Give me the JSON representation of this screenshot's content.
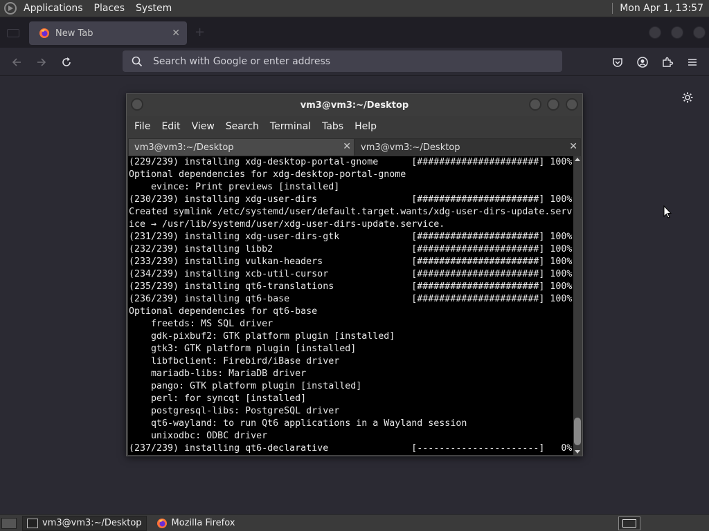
{
  "top_panel": {
    "menus": [
      "Applications",
      "Places",
      "System"
    ],
    "clock": "Mon Apr 1, 13:57"
  },
  "firefox": {
    "tab_title": "New Tab",
    "address_placeholder": "Search with Google or enter address"
  },
  "terminal": {
    "window_title": "vm3@vm3:~/Desktop",
    "menu": [
      "File",
      "Edit",
      "View",
      "Search",
      "Terminal",
      "Tabs",
      "Help"
    ],
    "tabs": [
      "vm3@vm3:~/Desktop",
      "vm3@vm3:~/Desktop"
    ],
    "lines": [
      "(229/239) installing xdg-desktop-portal-gnome      [######################] 100%",
      "Optional dependencies for xdg-desktop-portal-gnome",
      "    evince: Print previews [installed]",
      "(230/239) installing xdg-user-dirs                 [######################] 100%",
      "Created symlink /etc/systemd/user/default.target.wants/xdg-user-dirs-update.serv",
      "ice → /usr/lib/systemd/user/xdg-user-dirs-update.service.",
      "(231/239) installing xdg-user-dirs-gtk             [######################] 100%",
      "(232/239) installing libb2                         [######################] 100%",
      "(233/239) installing vulkan-headers                [######################] 100%",
      "(234/239) installing xcb-util-cursor               [######################] 100%",
      "(235/239) installing qt6-translations              [######################] 100%",
      "(236/239) installing qt6-base                      [######################] 100%",
      "Optional dependencies for qt6-base",
      "    freetds: MS SQL driver",
      "    gdk-pixbuf2: GTK platform plugin [installed]",
      "    gtk3: GTK platform plugin [installed]",
      "    libfbclient: Firebird/iBase driver",
      "    mariadb-libs: MariaDB driver",
      "    pango: GTK platform plugin [installed]",
      "    perl: for syncqt [installed]",
      "    postgresql-libs: PostgreSQL driver",
      "    qt6-wayland: to run Qt6 applications in a Wayland session",
      "    unixodbc: ODBC driver",
      "(237/239) installing qt6-declarative               [----------------------]   0%"
    ]
  },
  "taskbar": {
    "items": [
      "vm3@vm3:~/Desktop",
      "Mozilla Firefox"
    ]
  }
}
